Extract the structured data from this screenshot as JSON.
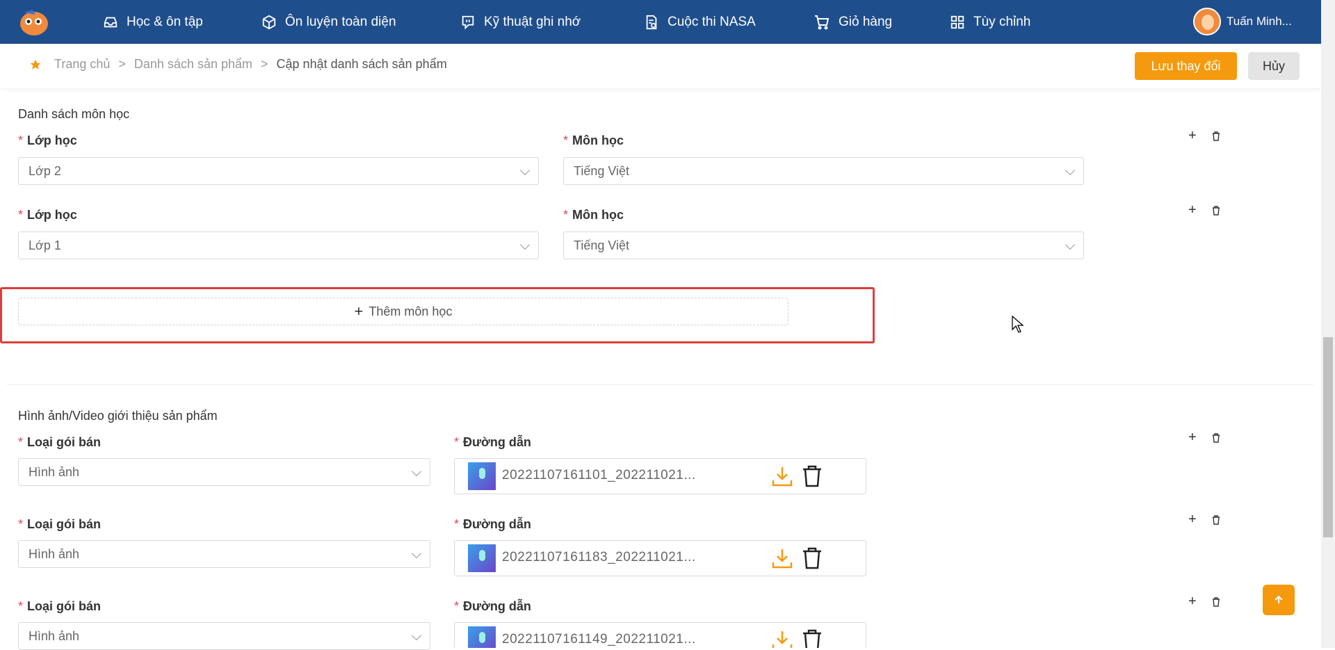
{
  "nav": {
    "items": [
      {
        "label": "Học & ôn tập",
        "icon": "inbox-icon"
      },
      {
        "label": "Ôn luyện toàn diện",
        "icon": "cube-icon"
      },
      {
        "label": "Kỹ thuật ghi nhớ",
        "icon": "chat-icon"
      },
      {
        "label": "Cuộc thi NASA",
        "icon": "document-icon"
      },
      {
        "label": "Giỏ hàng",
        "icon": "cart-icon"
      },
      {
        "label": "Tùy chỉnh",
        "icon": "grid-icon"
      }
    ],
    "user_name": "Tuấn Minh..."
  },
  "breadcrumb": {
    "home": "Trang chủ",
    "sep": ">",
    "list": "Danh sách sản phẩm",
    "current": "Cập nhật danh sách sản phẩm"
  },
  "actions": {
    "save": "Lưu thay đổi",
    "cancel": "Hủy"
  },
  "subjects": {
    "title": "Danh sách môn học",
    "grade_label": "Lớp học",
    "subject_label": "Môn học",
    "rows": [
      {
        "grade": "Lớp 2",
        "subject": "Tiếng Việt"
      },
      {
        "grade": "Lớp 1",
        "subject": "Tiếng Việt"
      }
    ],
    "add_label": "Thêm môn học"
  },
  "media": {
    "title": "Hình ảnh/Video giới thiệu sản phẩm",
    "type_label": "Loại gói bán",
    "path_label": "Đường dẫn",
    "rows": [
      {
        "type": "Hình ảnh",
        "file": "20221107161101_202211021..."
      },
      {
        "type": "Hình ảnh",
        "file": "20221107161183_202211021..."
      },
      {
        "type": "Hình ảnh",
        "file": "20221107161149_202211021..."
      }
    ]
  },
  "colors": {
    "primary": "#1f4e8c",
    "accent": "#f59a0e",
    "required": "#e5484d",
    "highlight": "#e03c3c"
  }
}
